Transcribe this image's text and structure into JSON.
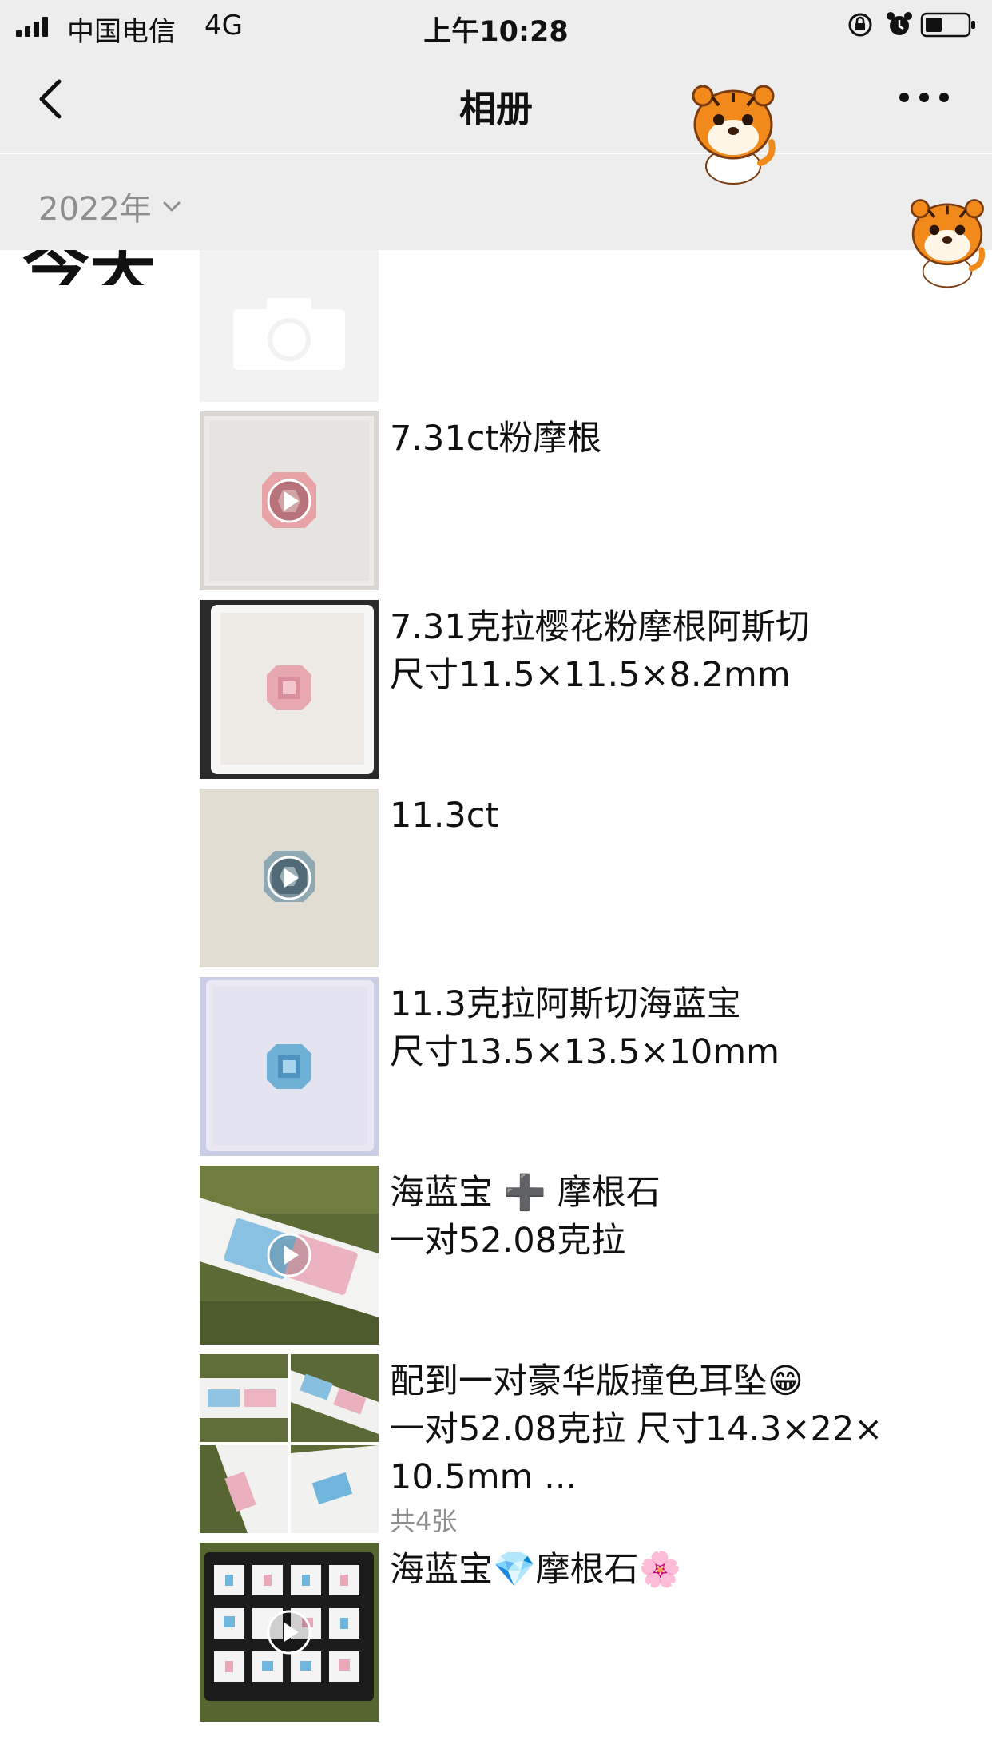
{
  "status_bar": {
    "carrier": "中国电信",
    "network": "4G",
    "time": "上午10:28"
  },
  "nav": {
    "title": "相册"
  },
  "filter": {
    "year": "2022年"
  },
  "day_label": "今天",
  "items": [
    {
      "lines": [
        "7.31ct粉摩根"
      ],
      "media": "video"
    },
    {
      "lines": [
        "7.31克拉樱花粉摩根阿斯切",
        "尺寸11.5×11.5×8.2mm"
      ],
      "media": "photo"
    },
    {
      "lines": [
        "11.3ct"
      ],
      "media": "video"
    },
    {
      "lines": [
        "11.3克拉阿斯切海蓝宝",
        "尺寸13.5×13.5×10mm"
      ],
      "media": "photo"
    },
    {
      "lines": [
        "海蓝宝 ➕ 摩根石",
        "一对52.08克拉"
      ],
      "media": "video"
    },
    {
      "lines": [
        "配到一对豪华版撞色耳坠😁",
        "一对52.08克拉 尺寸14.3×22×",
        "10.5mm ..."
      ],
      "count": "共4张",
      "media": "photo-grid"
    },
    {
      "lines": [
        "海蓝宝💎摩根石🌸"
      ],
      "media": "video"
    }
  ],
  "colors": {
    "header_bg": "#ededed",
    "muted_text": "#8e8e8e",
    "pink_gem": "#e9a4ad",
    "blue_gem": "#7fb5d8"
  }
}
